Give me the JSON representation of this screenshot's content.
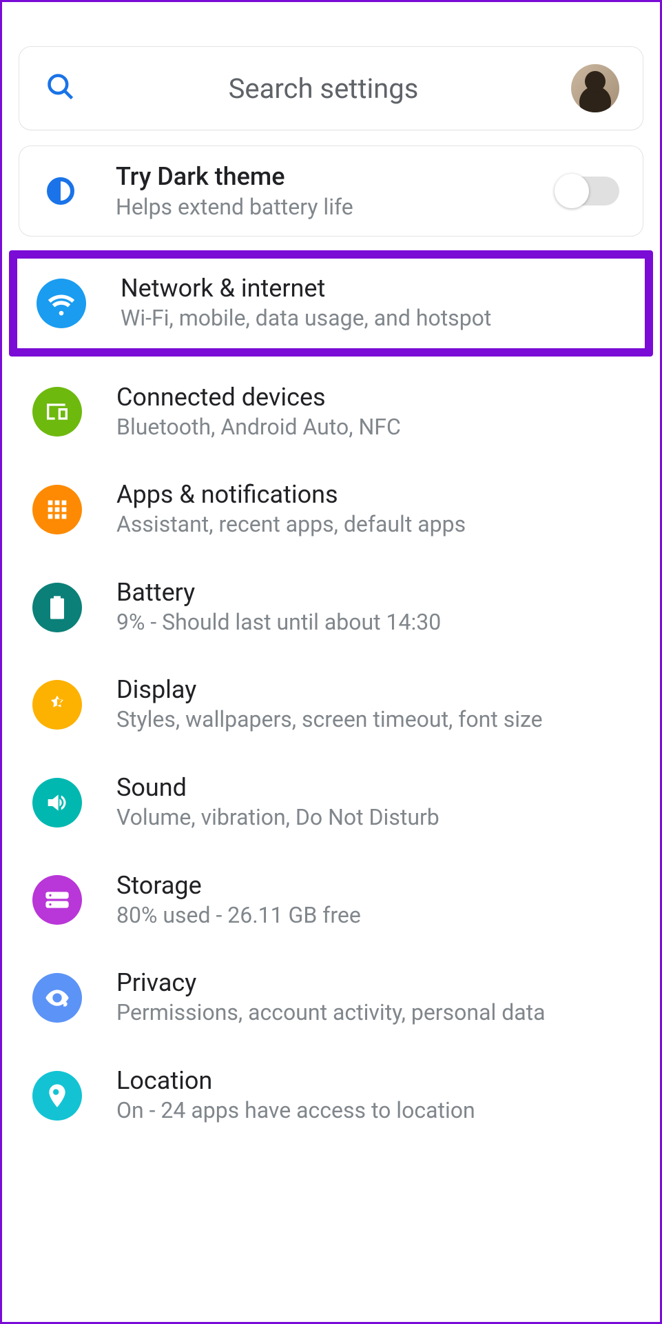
{
  "search": {
    "placeholder": "Search settings"
  },
  "dark": {
    "title": "Try Dark theme",
    "sub": "Helps extend battery life",
    "toggle": false
  },
  "items": [
    {
      "icon": "wifi-icon",
      "color": "c-blue",
      "title": "Network & internet",
      "sub": "Wi-Fi, mobile, data usage, and hotspot",
      "highlight": true
    },
    {
      "icon": "devices-icon",
      "color": "c-green",
      "title": "Connected devices",
      "sub": "Bluetooth, Android Auto, NFC"
    },
    {
      "icon": "apps-icon",
      "color": "c-orange",
      "title": "Apps & notifications",
      "sub": "Assistant, recent apps, default apps"
    },
    {
      "icon": "battery-icon",
      "color": "c-teal",
      "title": "Battery",
      "sub": "9% - Should last until about 14:30"
    },
    {
      "icon": "display-icon",
      "color": "c-amber",
      "title": "Display",
      "sub": "Styles, wallpapers, screen timeout, font size"
    },
    {
      "icon": "sound-icon",
      "color": "c-cyan",
      "title": "Sound",
      "sub": "Volume, vibration, Do Not Disturb"
    },
    {
      "icon": "storage-icon",
      "color": "c-purple",
      "title": "Storage",
      "sub": "80% used - 26.11 GB free"
    },
    {
      "icon": "privacy-icon",
      "color": "c-lblue",
      "title": "Privacy",
      "sub": "Permissions, account activity, personal data"
    },
    {
      "icon": "location-icon",
      "color": "c-turq",
      "title": "Location",
      "sub": "On - 24 apps have access to location"
    }
  ]
}
